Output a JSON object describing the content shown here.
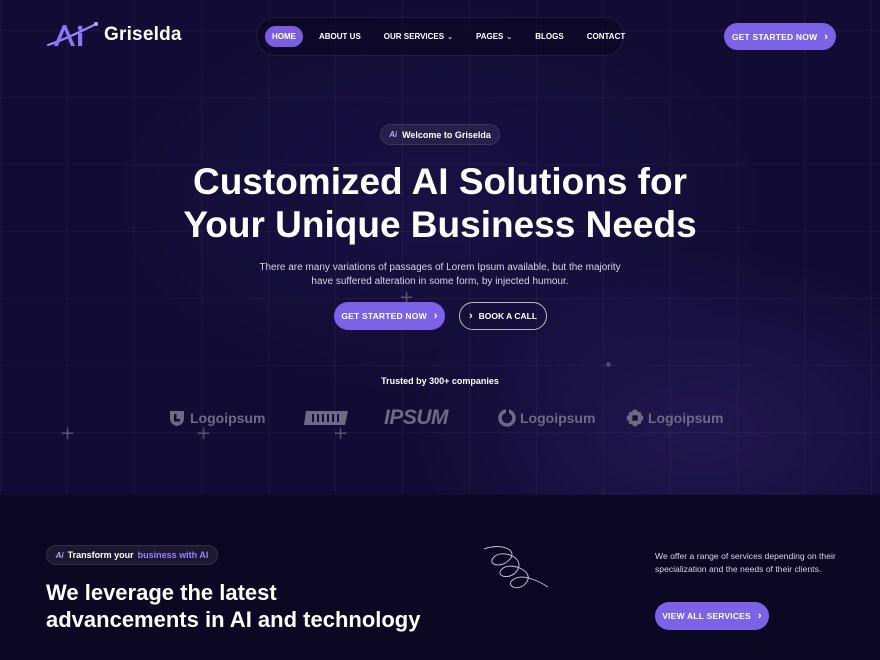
{
  "brand": {
    "name": "Griselda",
    "accent": "#7c62e6"
  },
  "nav": {
    "items": [
      {
        "label": "HOME",
        "active": true,
        "dropdown": false
      },
      {
        "label": "ABOUT US",
        "active": false,
        "dropdown": false
      },
      {
        "label": "OUR SERVICES",
        "active": false,
        "dropdown": true
      },
      {
        "label": "PAGES",
        "active": false,
        "dropdown": true
      },
      {
        "label": "BLOGS",
        "active": false,
        "dropdown": false
      },
      {
        "label": "CONTACT",
        "active": false,
        "dropdown": false
      }
    ],
    "cta_label": "GET STARTED NOW"
  },
  "hero": {
    "badge_mark": "Ai",
    "badge_label": "Welcome to Griselda",
    "title_line1": "Customized AI Solutions for",
    "title_line2": "Your Unique Business Needs",
    "subtitle": "There are many variations of passages of Lorem Ipsum available, but the majority have suffered alteration in some form, by injected humour.",
    "primary_cta": "GET STARTED NOW",
    "secondary_cta": "BOOK A CALL",
    "trusted_label": "Trusted by 300+ companies",
    "logos": [
      "Logoipsum",
      "IPSUM",
      "Logoipsum",
      "Logoipsum"
    ]
  },
  "services_intro": {
    "badge_mark": "Ai",
    "badge_prefix": "Transform your",
    "badge_highlight": "business with AI",
    "title_line1": "We leverage the latest",
    "title_line2": "advancements in AI and technology",
    "description": "We offer a range of services depending on their specialization and the needs of their clients.",
    "cta_label": "VIEW ALL SERVICES"
  },
  "icons": {
    "logo": "ai-logo-icon",
    "chevron": "chevron-down-icon",
    "arrow": "chevron-right-icon"
  }
}
